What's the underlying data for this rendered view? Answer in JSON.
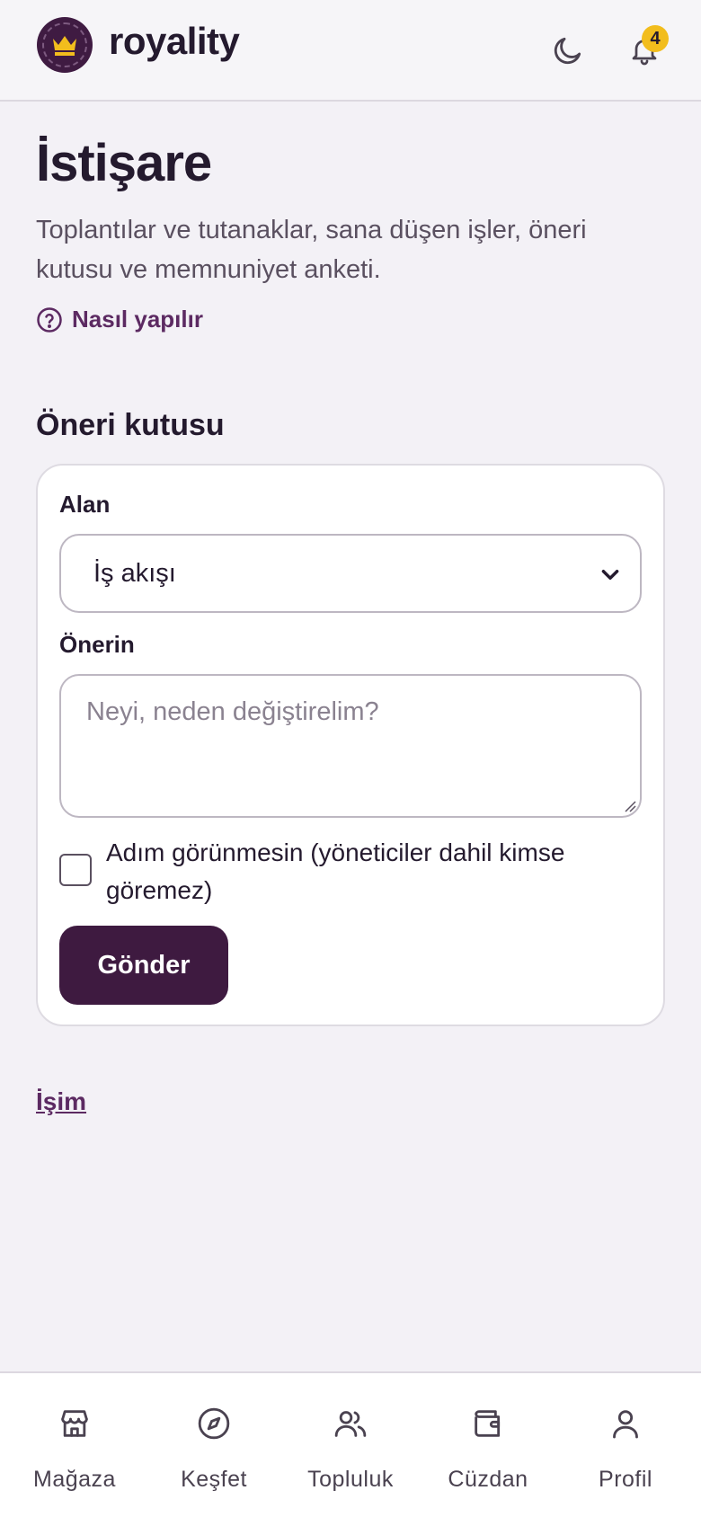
{
  "header": {
    "brand": "royality",
    "notification_count": "4"
  },
  "page": {
    "title": "İstişare",
    "description": "Toplantılar ve tutanaklar, sana düşen işler, öneri kutusu ve memnuniyet anketi.",
    "howto_label": "Nasıl yapılır"
  },
  "suggestion_box": {
    "title": "Öneri kutusu",
    "area_label": "Alan",
    "area_selected": "İş akışı",
    "suggestion_label": "Önerin",
    "suggestion_placeholder": "Neyi, neden değiştirelim?",
    "anonymous_label": "Adım görünmesin (yöneticiler dahil kimse göremez)",
    "anonymous_checked": false,
    "submit_label": "Gönder"
  },
  "my_job_link": "İşim",
  "bottom_nav": {
    "items": [
      {
        "label": "Mağaza",
        "icon": "store-icon"
      },
      {
        "label": "Keşfet",
        "icon": "compass-icon"
      },
      {
        "label": "Topluluk",
        "icon": "users-icon"
      },
      {
        "label": "Cüzdan",
        "icon": "wallet-icon"
      },
      {
        "label": "Profil",
        "icon": "user-icon"
      }
    ]
  },
  "colors": {
    "brand": "#3e1a40",
    "accent_link": "#5c2a62",
    "badge": "#f2bd1d",
    "background": "#f3f1f6"
  }
}
